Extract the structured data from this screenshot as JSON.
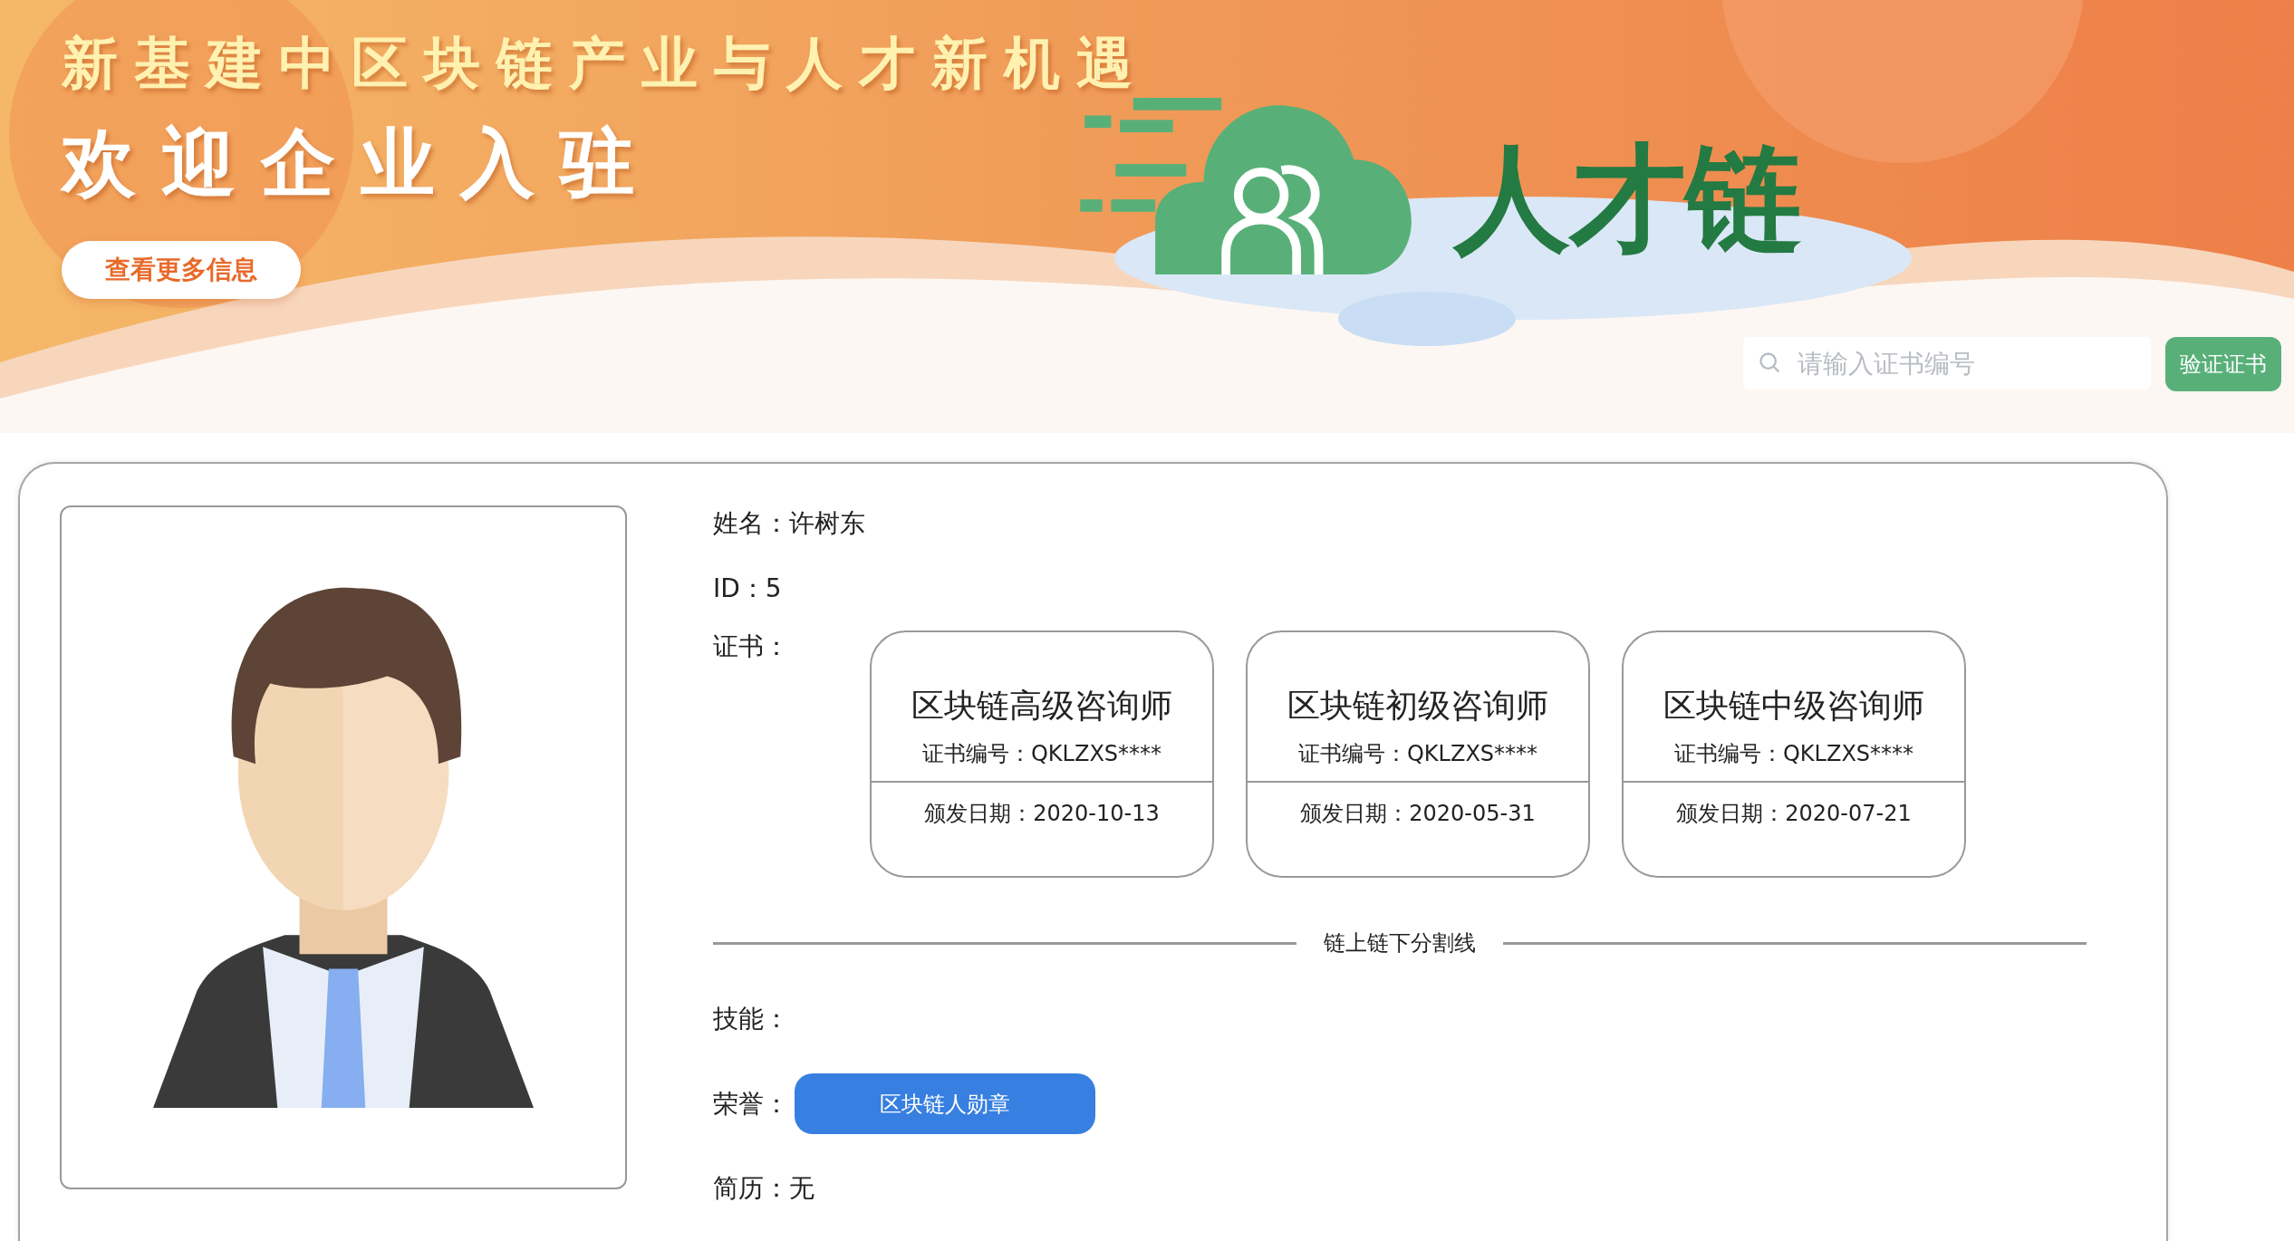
{
  "banner": {
    "headline": "新基建中区块链产业与人才新机遇",
    "subheadline": "欢迎企业入驻",
    "more_button": "查看更多信息",
    "logo_text": "人才链"
  },
  "search": {
    "placeholder": "请输入证书编号",
    "button": "验证证书"
  },
  "profile": {
    "name_label": "姓名：",
    "name": "许树东",
    "id_label": "ID：",
    "id": "5",
    "cert_label": "证书：",
    "certificates": [
      {
        "title": "区块链高级咨询师",
        "number_label": "证书编号：",
        "number": "QKLZXS****",
        "date_label": "颁发日期：",
        "date": "2020-10-13"
      },
      {
        "title": "区块链初级咨询师",
        "number_label": "证书编号：",
        "number": "QKLZXS****",
        "date_label": "颁发日期：",
        "date": "2020-05-31"
      },
      {
        "title": "区块链中级咨询师",
        "number_label": "证书编号：",
        "number": "QKLZXS****",
        "date_label": "颁发日期：",
        "date": "2020-07-21"
      }
    ],
    "divider": "链上链下分割线",
    "skills_label": "技能：",
    "honors_label": "荣誉：",
    "honors": [
      "区块链人勋章"
    ],
    "resume_label": "简历：",
    "resume": "无"
  }
}
